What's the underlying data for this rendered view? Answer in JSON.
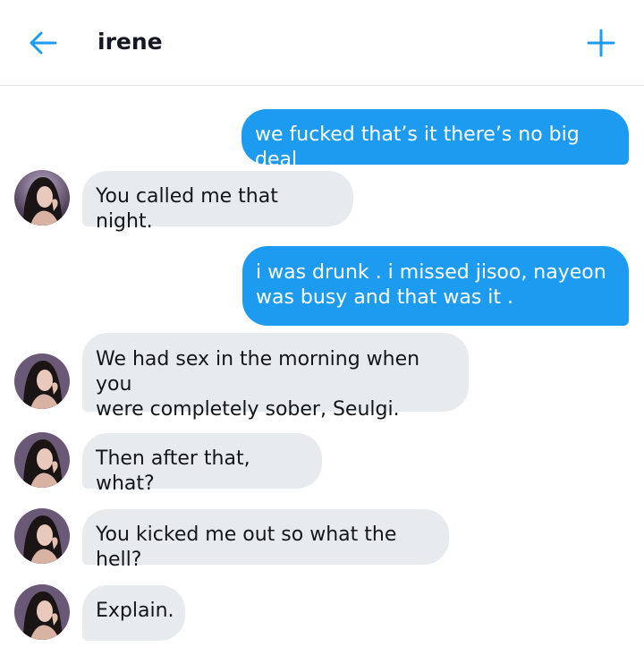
{
  "header": {
    "back_icon": "arrow-left-icon",
    "title": "irene",
    "add_icon": "plus-icon",
    "accent_color": "#1d9bf0"
  },
  "contact": {
    "avatar_icon": "contact-avatar"
  },
  "messages": [
    {
      "from": "me",
      "text": "we fucked that’s it there’s no big deal"
    },
    {
      "from": "them",
      "text": "You called me that night."
    },
    {
      "from": "me",
      "text": "i was drunk . i missed jisoo, nayeon\nwas busy and that was it ."
    },
    {
      "from": "them",
      "text": "We had sex in the morning when you\nwere completely sober, Seulgi."
    },
    {
      "from": "them",
      "text": "Then after that, what?"
    },
    {
      "from": "them",
      "text": "You kicked me out so what the hell?"
    },
    {
      "from": "them",
      "text": "Explain."
    }
  ],
  "colors": {
    "sent_bubble": "#1d9bf0",
    "received_bubble": "#e8ebee"
  }
}
